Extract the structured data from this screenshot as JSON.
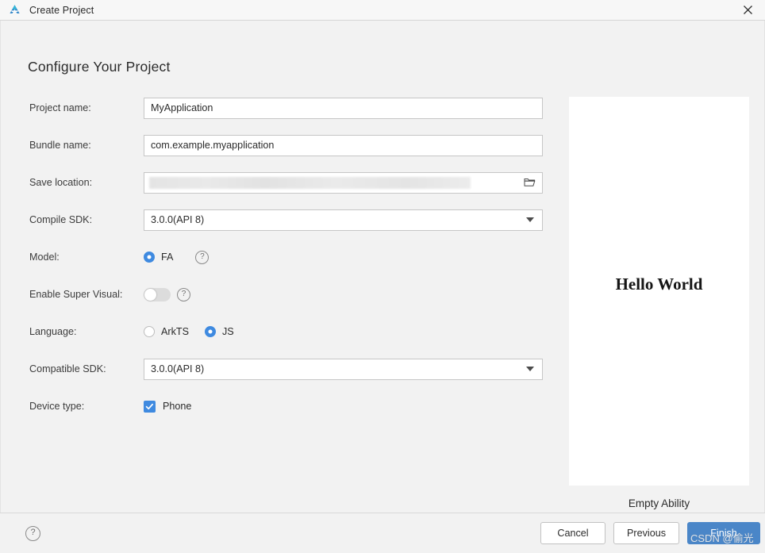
{
  "window": {
    "title": "Create Project",
    "logo_icon": "deveco-logo-icon",
    "close_icon": "close-icon"
  },
  "heading": "Configure Your Project",
  "form": {
    "project_name": {
      "label": "Project name:",
      "value": "MyApplication"
    },
    "bundle_name": {
      "label": "Bundle name:",
      "value": "com.example.myapplication"
    },
    "save_location": {
      "label": "Save location:",
      "value": "",
      "browse_icon": "folder-open-icon"
    },
    "compile_sdk": {
      "label": "Compile SDK:",
      "value": "3.0.0(API 8)",
      "caret_icon": "chevron-down-icon"
    },
    "model": {
      "label": "Model:",
      "options": [
        {
          "label": "FA",
          "selected": true
        }
      ],
      "help_icon": "help-circle-icon",
      "help_label": "?"
    },
    "super_visual": {
      "label": "Enable Super Visual:",
      "enabled": false,
      "help_icon": "help-circle-icon",
      "help_label": "?"
    },
    "language": {
      "label": "Language:",
      "options": [
        {
          "label": "ArkTS",
          "selected": false
        },
        {
          "label": "JS",
          "selected": true
        }
      ]
    },
    "compatible_sdk": {
      "label": "Compatible SDK:",
      "value": "3.0.0(API 8)",
      "caret_icon": "chevron-down-icon"
    },
    "device_type": {
      "label": "Device type:",
      "options": [
        {
          "label": "Phone",
          "checked": true
        }
      ]
    }
  },
  "preview": {
    "screen_text": "Hello World",
    "caption": "Empty Ability"
  },
  "footer": {
    "help_label": "?",
    "help_icon": "help-circle-icon",
    "cancel_label": "Cancel",
    "previous_label": "Previous",
    "finish_label": "Finish"
  },
  "watermark": "CSDN @偷光",
  "colors": {
    "accent": "#3f8ae0",
    "primary_button": "#4a86c8",
    "background": "#f2f2f2",
    "field_background": "#ffffff"
  }
}
